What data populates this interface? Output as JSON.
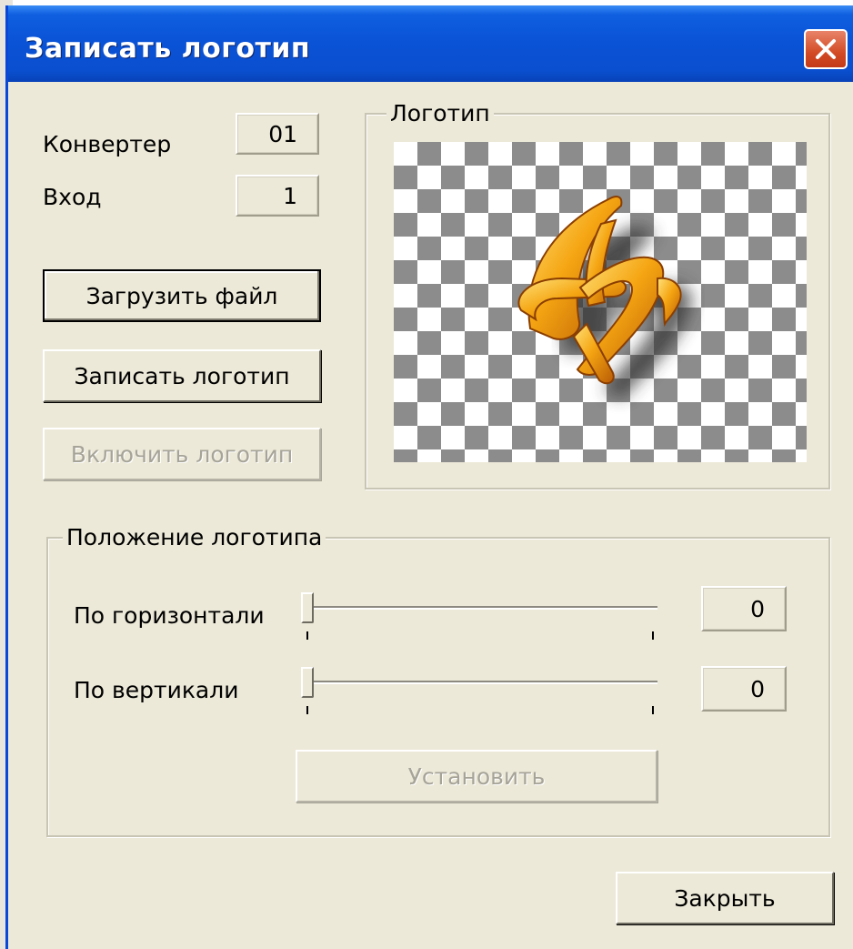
{
  "window": {
    "title": "Записать логотип",
    "close_icon": "close-icon"
  },
  "converter": {
    "label": "Конвертер",
    "value": "01"
  },
  "input": {
    "label": "Вход",
    "value": "1"
  },
  "buttons": {
    "load_file": "Загрузить файл",
    "write_logo": "Записать логотип",
    "enable_logo": "Включить логотип",
    "set": "Установить",
    "close": "Закрыть"
  },
  "logo_group": {
    "legend": "Логотип",
    "preview_icon": "logo-preview-image"
  },
  "position_group": {
    "legend": "Положение логотипа",
    "horizontal": {
      "label": "По горизонтали",
      "value": "0",
      "level": 0
    },
    "vertical": {
      "label": "По вертикали",
      "value": "0",
      "level": 0
    }
  },
  "colors": {
    "titlebar": "#0a52d6",
    "close": "#d34b25",
    "logo_orange": "#f39a10"
  }
}
